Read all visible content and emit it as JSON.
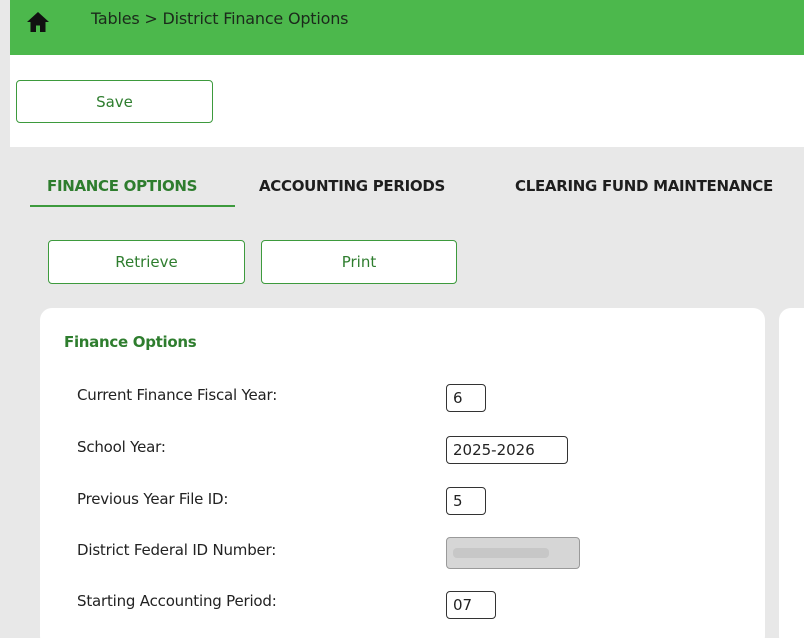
{
  "header": {
    "breadcrumb": "Tables > District Finance Options"
  },
  "toolbar": {
    "save_label": "Save"
  },
  "tabs": [
    {
      "label": "FINANCE OPTIONS"
    },
    {
      "label": "ACCOUNTING PERIODS"
    },
    {
      "label": "CLEARING FUND MAINTENANCE"
    }
  ],
  "actions": {
    "retrieve_label": "Retrieve",
    "print_label": "Print"
  },
  "panel": {
    "title": "Finance Options",
    "fields": [
      {
        "label": "Current Finance Fiscal Year:",
        "value": "6"
      },
      {
        "label": "School Year:",
        "value": "2025-2026"
      },
      {
        "label": "Previous Year File ID:",
        "value": "5"
      },
      {
        "label": "District Federal ID Number:",
        "value": ""
      },
      {
        "label": "Starting Accounting Period:",
        "value": "07"
      }
    ]
  },
  "colors": {
    "header_bg": "#4cb84c",
    "accent": "#2e7d2e",
    "page_bg": "#e8e8e8"
  }
}
